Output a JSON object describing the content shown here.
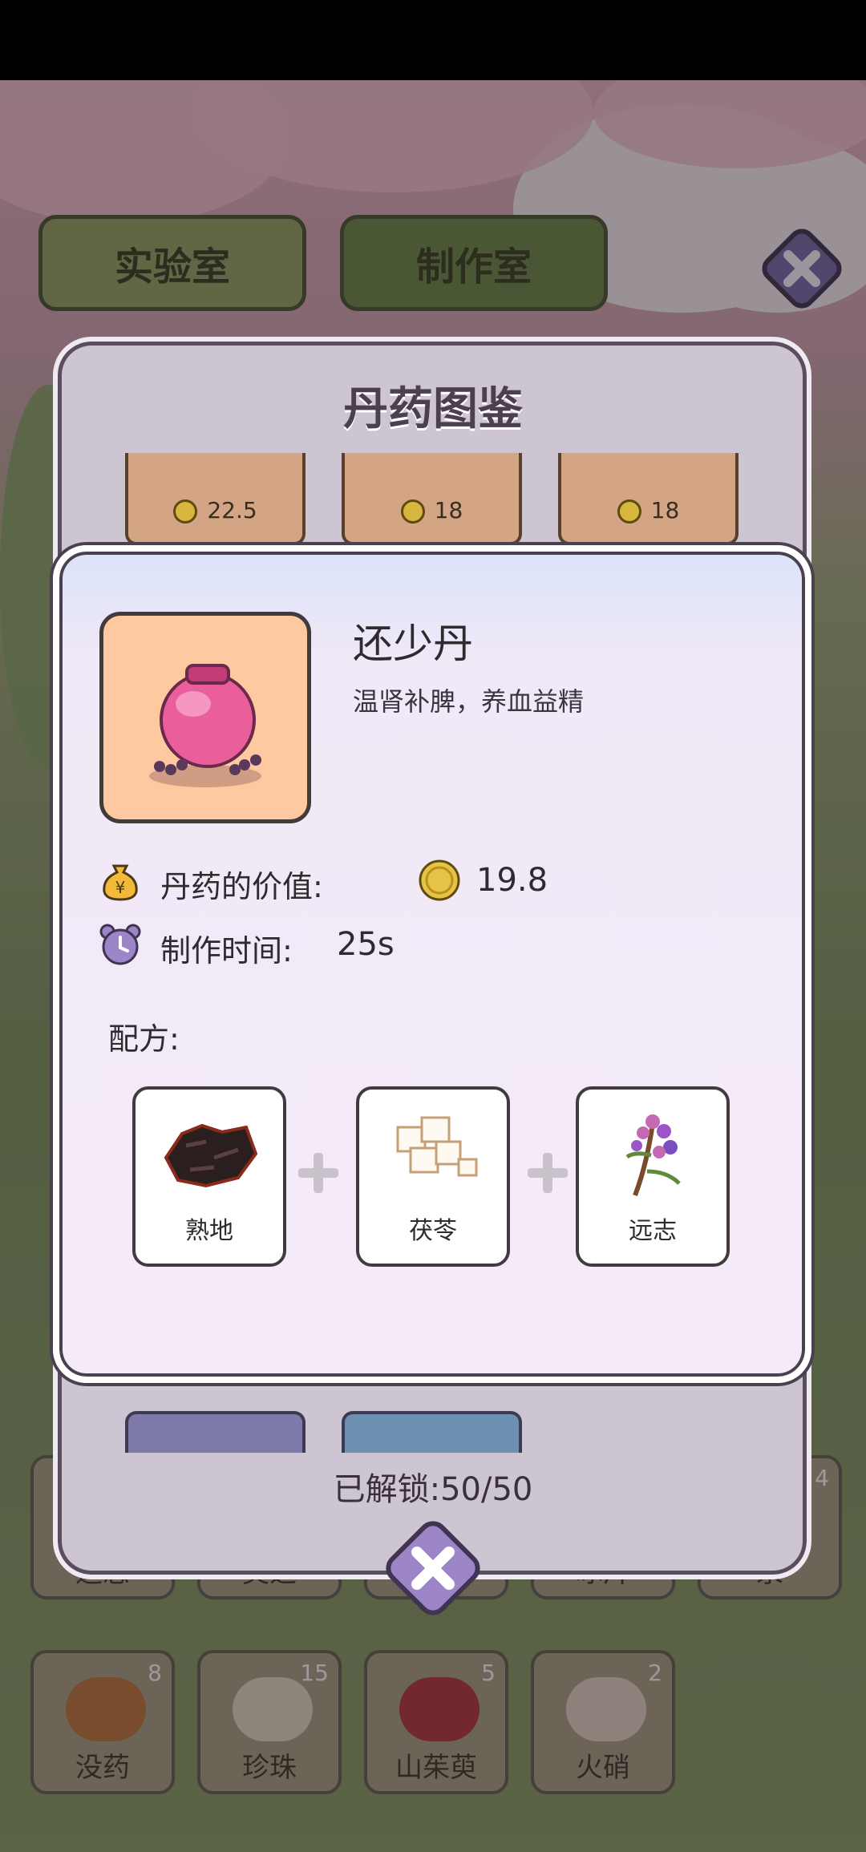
{
  "top_tabs": {
    "lab": "实验室",
    "craft": "制作室"
  },
  "codex": {
    "title": "丹药图鉴",
    "card_prices": [
      "22.5",
      "18",
      "18"
    ],
    "unlocked": "已解锁:50/50"
  },
  "detail": {
    "name": "还少丹",
    "description": "温肾补脾，养血益精",
    "value_label": "丹药的价值:",
    "value": "19.8",
    "time_label": "制作时间:",
    "time": "25s",
    "recipe_label": "配方:",
    "ingredients": [
      {
        "name": "熟地",
        "icon": "rehmannia-icon"
      },
      {
        "name": "茯苓",
        "icon": "poria-icon"
      },
      {
        "name": "远志",
        "icon": "polygala-icon"
      }
    ]
  },
  "inventory": {
    "row1": [
      {
        "name": "远志",
        "count": ""
      },
      {
        "name": "灵芝",
        "count": ""
      },
      {
        "name": "",
        "count": ""
      },
      {
        "name": "冰片",
        "count": ""
      },
      {
        "name": "汞",
        "count": "4"
      }
    ],
    "row2": [
      {
        "name": "没药",
        "count": "8"
      },
      {
        "name": "珍珠",
        "count": "15"
      },
      {
        "name": "山茱萸",
        "count": "5"
      },
      {
        "name": "火硝",
        "count": "2"
      }
    ]
  },
  "colors": {
    "coin": "#d7b640",
    "accent_purple": "#9c86c8",
    "popup_bg": "#f5eaf8"
  }
}
